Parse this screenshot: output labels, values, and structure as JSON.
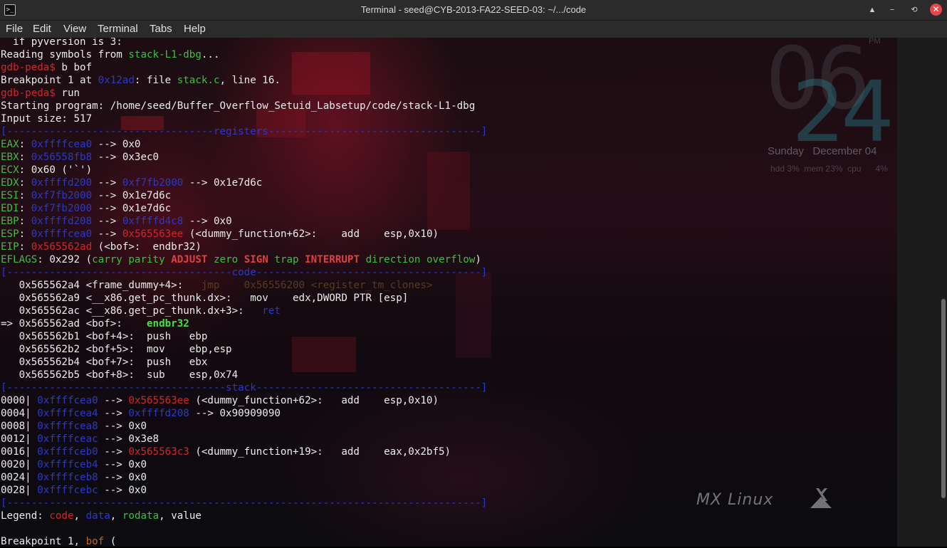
{
  "window": {
    "title": "Terminal - seed@CYB-2013-FA22-SEED-03: ~/.../code",
    "controls": [
      "▲",
      "−",
      "⟲",
      "✕"
    ]
  },
  "menu": [
    "File",
    "Edit",
    "View",
    "Terminal",
    "Tabs",
    "Help"
  ],
  "desktop": {
    "clock_hour": "06",
    "clock_minute": "24",
    "clock_ampm": "PM",
    "day": "Sunday",
    "date": "December 04",
    "hdd": "hdd",
    "hdd_pct": "3%",
    "mem": "mem",
    "mem_pct": "23%",
    "cpu": "cpu",
    "cpu_pct": "4%",
    "brand": "MX Linux"
  },
  "terminal": {
    "lines": [
      [
        {
          "t": "  if pyversion is 3:"
        }
      ],
      [
        {
          "t": "Reading symbols from "
        },
        {
          "t": "stack-L1-dbg",
          "c": "g"
        },
        {
          "t": "..."
        }
      ],
      [
        {
          "t": "gdb-peda$",
          "c": "r"
        },
        {
          "t": " b bof"
        }
      ],
      [
        {
          "t": "Breakpoint 1 at "
        },
        {
          "t": "0x12ad",
          "c": "b"
        },
        {
          "t": ": file "
        },
        {
          "t": "stack.c",
          "c": "g"
        },
        {
          "t": ", line 16."
        }
      ],
      [
        {
          "t": "gdb-peda$",
          "c": "r"
        },
        {
          "t": " run"
        }
      ],
      [
        {
          "t": "Starting program: /home/seed/Buffer_Overflow_Setuid_Labsetup/code/stack-L1-dbg"
        }
      ],
      [
        {
          "t": "Input size: 517"
        }
      ],
      [
        {
          "t": "[----------------------------------registers-----------------------------------]",
          "c": "b"
        }
      ],
      [
        {
          "t": "EAX",
          "c": "g"
        },
        {
          "t": ": "
        },
        {
          "t": "0xffffcea0",
          "c": "b"
        },
        {
          "t": " --> 0x0"
        }
      ],
      [
        {
          "t": "EBX",
          "c": "g"
        },
        {
          "t": ": "
        },
        {
          "t": "0x56558fb8",
          "c": "b"
        },
        {
          "t": " --> 0x3ec0"
        }
      ],
      [
        {
          "t": "ECX",
          "c": "g"
        },
        {
          "t": ": 0x60 ('`')"
        }
      ],
      [
        {
          "t": "EDX",
          "c": "g"
        },
        {
          "t": ": "
        },
        {
          "t": "0xffffd200",
          "c": "b"
        },
        {
          "t": " --> "
        },
        {
          "t": "0xf7fb2000",
          "c": "b"
        },
        {
          "t": " --> 0x1e7d6c"
        }
      ],
      [
        {
          "t": "ESI",
          "c": "g"
        },
        {
          "t": ": "
        },
        {
          "t": "0xf7fb2000",
          "c": "b"
        },
        {
          "t": " --> 0x1e7d6c"
        }
      ],
      [
        {
          "t": "EDI",
          "c": "g"
        },
        {
          "t": ": "
        },
        {
          "t": "0xf7fb2000",
          "c": "b"
        },
        {
          "t": " --> 0x1e7d6c"
        }
      ],
      [
        {
          "t": "EBP",
          "c": "g"
        },
        {
          "t": ": "
        },
        {
          "t": "0xffffd208",
          "c": "b"
        },
        {
          "t": " --> "
        },
        {
          "t": "0xffffd4c8",
          "c": "b"
        },
        {
          "t": " --> 0x0"
        }
      ],
      [
        {
          "t": "ESP",
          "c": "g"
        },
        {
          "t": ": "
        },
        {
          "t": "0xffffcea0",
          "c": "b"
        },
        {
          "t": " --> "
        },
        {
          "t": "0x565563ee",
          "c": "r"
        },
        {
          "t": " (<dummy_function+62>:    add    esp,0x10)"
        }
      ],
      [
        {
          "t": "EIP",
          "c": "g"
        },
        {
          "t": ": "
        },
        {
          "t": "0x565562ad",
          "c": "r"
        },
        {
          "t": " (<bof>:  endbr32)"
        }
      ],
      [
        {
          "t": "EFLAGS",
          "c": "g"
        },
        {
          "t": ": 0x292 ("
        },
        {
          "t": "carry",
          "c": "g"
        },
        {
          "t": " "
        },
        {
          "t": "parity",
          "c": "g"
        },
        {
          "t": " "
        },
        {
          "t": "ADJUST",
          "c": "rb"
        },
        {
          "t": " "
        },
        {
          "t": "zero",
          "c": "g"
        },
        {
          "t": " "
        },
        {
          "t": "SIGN",
          "c": "rb"
        },
        {
          "t": " "
        },
        {
          "t": "trap",
          "c": "g"
        },
        {
          "t": " "
        },
        {
          "t": "INTERRUPT",
          "c": "rb"
        },
        {
          "t": " "
        },
        {
          "t": "direction",
          "c": "g"
        },
        {
          "t": " "
        },
        {
          "t": "overflow",
          "c": "g"
        },
        {
          "t": ")"
        }
      ],
      [
        {
          "t": "[-------------------------------------code-------------------------------------]",
          "c": "b"
        }
      ],
      [
        {
          "t": "   0x565562a4 <frame_dummy+4>:   "
        },
        {
          "t": "jmp    0x56556200 <register_tm_clones>",
          "c": "dim"
        }
      ],
      [
        {
          "t": "   0x565562a9 <__x86.get_pc_thunk.dx>:   mov    edx,DWORD PTR [esp]"
        }
      ],
      [
        {
          "t": "   0x565562ac <__x86.get_pc_thunk.dx+3>:   "
        },
        {
          "t": "ret",
          "c": "b"
        }
      ],
      [
        {
          "t": "=> 0x565562ad <bof>:    "
        },
        {
          "t": "endbr32",
          "c": "gb"
        }
      ],
      [
        {
          "t": "   0x565562b1 <bof+4>:  push   ebp"
        }
      ],
      [
        {
          "t": "   0x565562b2 <bof+5>:  mov    ebp,esp"
        }
      ],
      [
        {
          "t": "   0x565562b4 <bof+7>:  push   ebx"
        }
      ],
      [
        {
          "t": "   0x565562b5 <bof+8>:  sub    esp,0x74"
        }
      ],
      [
        {
          "t": "[------------------------------------stack-------------------------------------]",
          "c": "b"
        }
      ],
      [
        {
          "t": "0000| "
        },
        {
          "t": "0xffffcea0",
          "c": "b"
        },
        {
          "t": " --> "
        },
        {
          "t": "0x565563ee",
          "c": "r"
        },
        {
          "t": " (<dummy_function+62>:   add    esp,0x10)"
        }
      ],
      [
        {
          "t": "0004| "
        },
        {
          "t": "0xffffcea4",
          "c": "b"
        },
        {
          "t": " --> "
        },
        {
          "t": "0xffffd208",
          "c": "b"
        },
        {
          "t": " --> 0x90909090"
        }
      ],
      [
        {
          "t": "0008| "
        },
        {
          "t": "0xffffcea8",
          "c": "b"
        },
        {
          "t": " --> 0x0"
        }
      ],
      [
        {
          "t": "0012| "
        },
        {
          "t": "0xffffceac",
          "c": "b"
        },
        {
          "t": " --> 0x3e8"
        }
      ],
      [
        {
          "t": "0016| "
        },
        {
          "t": "0xffffceb0",
          "c": "b"
        },
        {
          "t": " --> "
        },
        {
          "t": "0x565563c3",
          "c": "r"
        },
        {
          "t": " (<dummy_function+19>:   add    eax,0x2bf5)"
        }
      ],
      [
        {
          "t": "0020| "
        },
        {
          "t": "0xffffceb4",
          "c": "b"
        },
        {
          "t": " --> 0x0"
        }
      ],
      [
        {
          "t": "0024| "
        },
        {
          "t": "0xffffceb8",
          "c": "b"
        },
        {
          "t": " --> 0x0"
        }
      ],
      [
        {
          "t": "0028| "
        },
        {
          "t": "0xffffcebc",
          "c": "b"
        },
        {
          "t": " --> 0x0"
        }
      ],
      [
        {
          "t": "[------------------------------------------------------------------------------]",
          "c": "b"
        }
      ],
      [
        {
          "t": "Legend: "
        },
        {
          "t": "code",
          "c": "r"
        },
        {
          "t": ", "
        },
        {
          "t": "data",
          "c": "b"
        },
        {
          "t": ", "
        },
        {
          "t": "rodata",
          "c": "g"
        },
        {
          "t": ", value"
        }
      ],
      [
        {
          "t": ""
        }
      ],
      [
        {
          "t": "Breakpoint 1, "
        },
        {
          "t": "bof",
          "c": "o"
        },
        {
          "t": " ("
        }
      ]
    ]
  }
}
